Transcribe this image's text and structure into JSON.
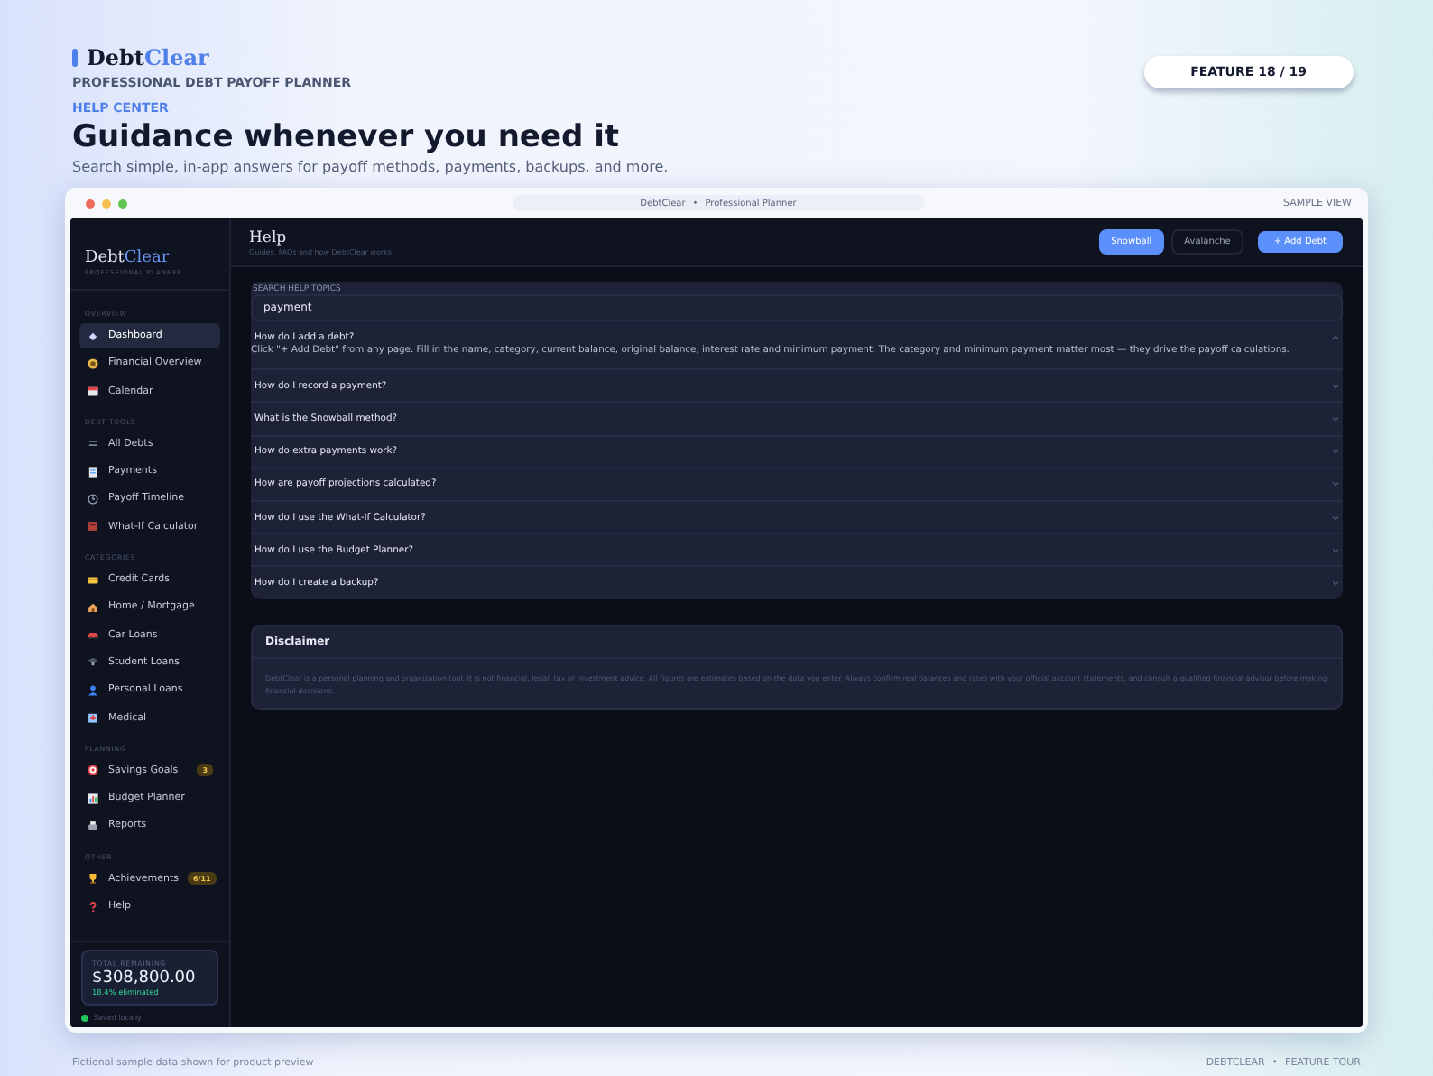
{
  "brand": {
    "logo_a": "Debt",
    "logo_b": "Clear",
    "tagline": "PROFESSIONAL DEBT PAYOFF PLANNER"
  },
  "eyebrow": "HELP CENTER",
  "heading": "Guidance whenever you need it",
  "subheading": "Search simple, in-app answers for payoff methods, payments, backups, and more.",
  "feature_badge": "FEATURE 18 / 19",
  "window": {
    "title_app": "DebtClear",
    "separator": "•",
    "title_page": "Professional Planner",
    "tag": "SAMPLE VIEW"
  },
  "sidebar": {
    "logo_a": "Debt",
    "logo_b": "Clear",
    "logo_sub": "PROFESSIONAL PLANNER",
    "sections": [
      {
        "label": "OVERVIEW",
        "items": [
          {
            "label": "Dashboard",
            "selected": true
          },
          {
            "label": "Financial Overview",
            "selected": false
          },
          {
            "label": "Calendar",
            "selected": false
          }
        ]
      },
      {
        "label": "DEBT TOOLS",
        "items": [
          {
            "label": "All Debts",
            "selected": false
          },
          {
            "label": "Payments",
            "selected": false
          },
          {
            "label": "Payoff Timeline",
            "selected": false
          },
          {
            "label": "What-If Calculator",
            "selected": false
          }
        ]
      },
      {
        "label": "CATEGORIES",
        "items": [
          {
            "label": "Credit Cards",
            "selected": false
          },
          {
            "label": "Home / Mortgage",
            "selected": false
          },
          {
            "label": "Car Loans",
            "selected": false
          },
          {
            "label": "Student Loans",
            "selected": false
          },
          {
            "label": "Personal Loans",
            "selected": false
          },
          {
            "label": "Medical",
            "selected": false
          }
        ]
      },
      {
        "label": "PLANNING",
        "items": [
          {
            "label": "Savings Goals",
            "selected": false,
            "badge": "3"
          },
          {
            "label": "Budget Planner",
            "selected": false
          },
          {
            "label": "Reports",
            "selected": false
          }
        ]
      },
      {
        "label": "OTHER",
        "items": [
          {
            "label": "Achievements",
            "selected": false,
            "badge": "6/11"
          },
          {
            "label": "Help",
            "selected": false
          }
        ]
      }
    ],
    "total": {
      "label": "TOTAL REMAINING",
      "amount": "$308,800.00",
      "note": "18.4% eliminated"
    },
    "saved": "Saved locally"
  },
  "page": {
    "title": "Help",
    "subtitle": "Guides, FAQs and how DebtClear works",
    "toggle": [
      {
        "label": "Snowball",
        "selected": true
      },
      {
        "label": "Avalanche",
        "selected": false
      }
    ],
    "add_button": "+ Add Debt"
  },
  "search": {
    "label": "SEARCH HELP TOPICS",
    "value": "payment"
  },
  "faq": [
    {
      "question": "How do I add a debt?",
      "expanded": true,
      "answer": "Click \"+ Add Debt\" from any page. Fill in the name, category, current balance, original balance, interest rate and minimum payment. The category and minimum payment matter most — they drive the payoff calculations."
    },
    {
      "question": "How do I record a payment?",
      "expanded": false
    },
    {
      "question": "What is the Snowball method?",
      "expanded": false
    },
    {
      "question": "How do extra payments work?",
      "expanded": false
    },
    {
      "question": "How are payoff projections calculated?",
      "expanded": false
    },
    {
      "question": "How do I use the What-If Calculator?",
      "expanded": false
    },
    {
      "question": "How do I use the Budget Planner?",
      "expanded": false
    },
    {
      "question": "How do I create a backup?",
      "expanded": false
    }
  ],
  "disclaimer": {
    "title": "Disclaimer",
    "text": "DebtClear is a personal planning and organization tool. It is not financial, legal, tax or investment advice. All figures are estimates based on the data you enter. Always confirm real balances and rates with your official account statements, and consult a qualified financial advisor before making financial decisions."
  },
  "footer": {
    "left": "Fictional sample data shown for product preview",
    "right_a": "DEBTCLEAR",
    "separator": "•",
    "right_b": "FEATURE TOUR"
  }
}
